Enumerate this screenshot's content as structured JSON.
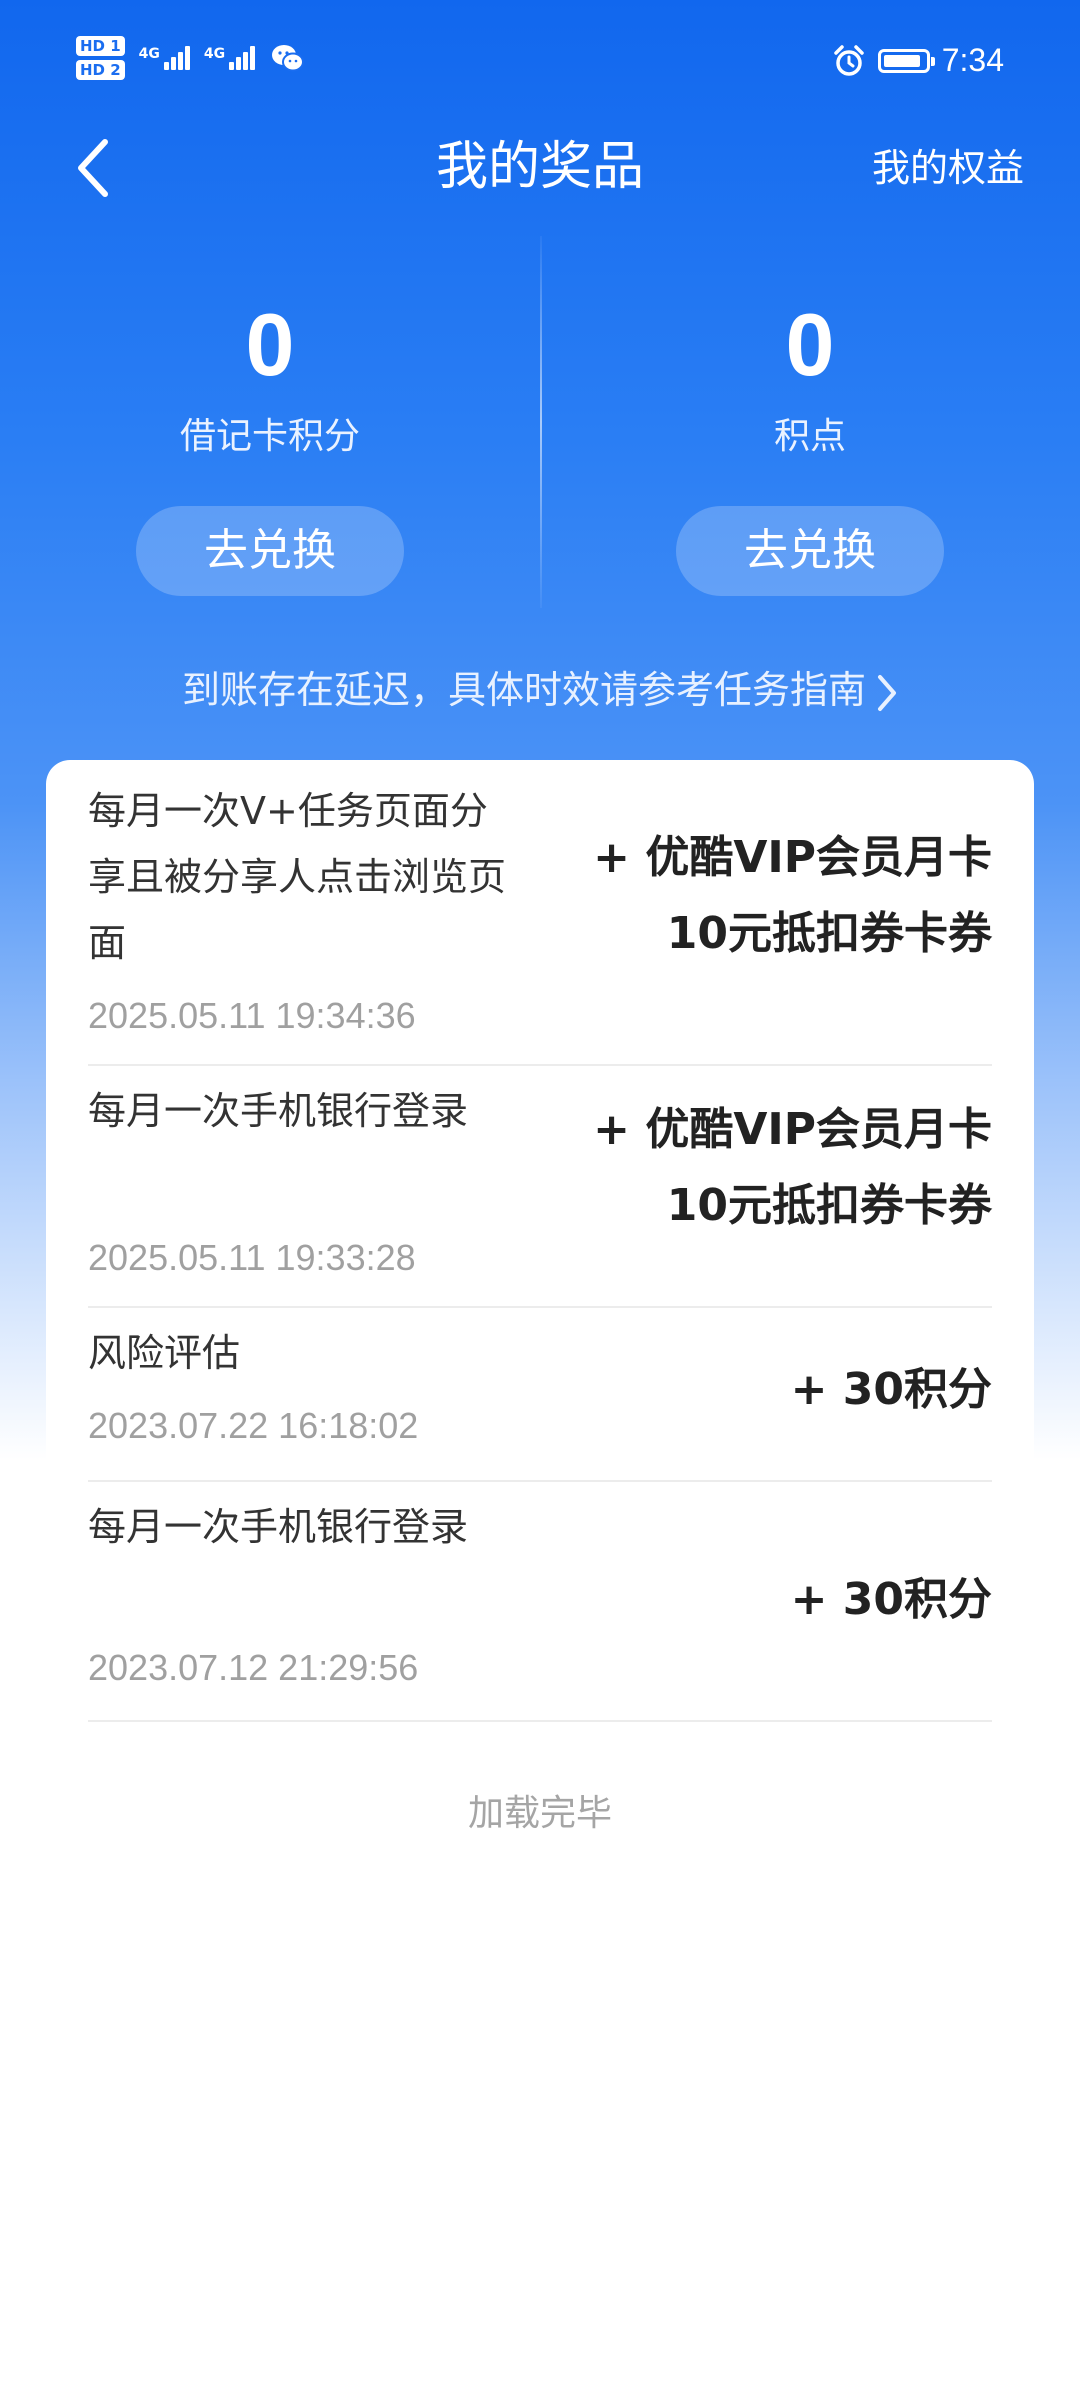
{
  "status_bar": {
    "hd1": "HD 1",
    "hd2": "HD 2",
    "net1": "4G",
    "net2": "4G",
    "time": "7:34"
  },
  "header": {
    "title": "我的奖品",
    "right_link": "我的权益"
  },
  "points": {
    "debit": {
      "value": "0",
      "label": "借记卡积分",
      "button": "去兑换"
    },
    "jidian": {
      "value": "0",
      "label": "积点",
      "button": "去兑换"
    }
  },
  "notice": "到账存在延迟，具体时效请参考任务指南",
  "records": [
    {
      "title": "每月一次V+任务页面分享且被分享人点击浏览页面",
      "time": "2025.05.11 19:34:36",
      "reward_line1": "+ 优酷VIP会员月卡",
      "reward_line2": "10元抵扣券卡券"
    },
    {
      "title": "每月一次手机银行登录",
      "time": "2025.05.11 19:33:28",
      "reward_line1": "+ 优酷VIP会员月卡",
      "reward_line2": "10元抵扣券卡券"
    },
    {
      "title": "风险评估",
      "time": "2023.07.22 16:18:02",
      "reward_line1": "+ 30积分",
      "reward_line2": ""
    },
    {
      "title": "每月一次手机银行登录",
      "time": "2023.07.12 21:29:56",
      "reward_line1": "+ 30积分",
      "reward_line2": ""
    }
  ],
  "footer": "加载完毕",
  "colors": {
    "brand_blue": "#1167ee",
    "text_dark": "#222222",
    "text_gray": "#a0a0a0"
  },
  "icons": [
    "back-arrow-icon",
    "chevron-right-icon",
    "alarm-icon",
    "battery-icon",
    "wechat-icon",
    "signal-icon"
  ]
}
